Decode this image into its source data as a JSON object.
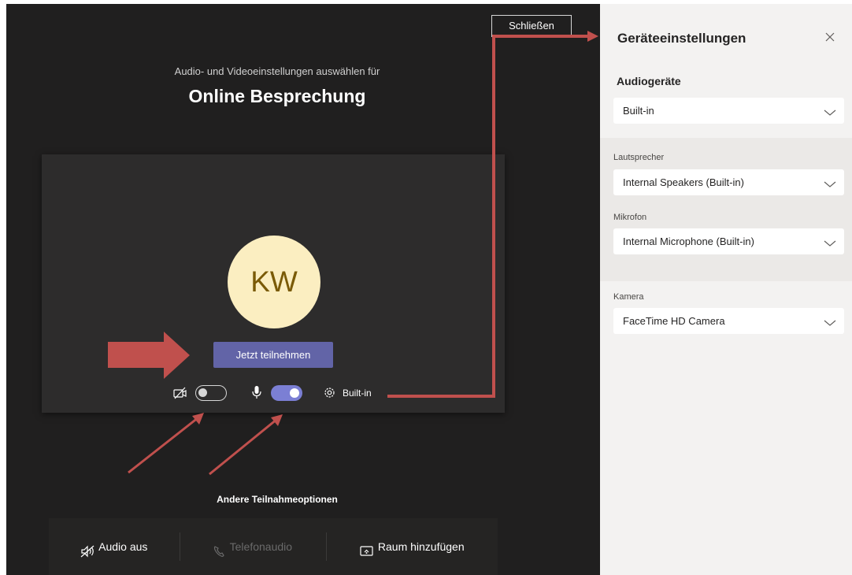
{
  "main": {
    "close_label": "Schließen",
    "subtitle": "Audio- und Videoeinstellungen auswählen für",
    "title": "Online Besprechung",
    "avatar_initials": "KW",
    "join_label": "Jetzt teilnehmen",
    "camera_toggle": {
      "on": false
    },
    "mic_toggle": {
      "on": true
    },
    "device_label": "Built-in",
    "other_options_title": "Andere Teilnahmeoptionen",
    "options": [
      {
        "label": "Audio aus",
        "icon": "speaker-off-icon",
        "enabled": true
      },
      {
        "label": "Telefonaudio",
        "icon": "phone-icon",
        "enabled": false
      },
      {
        "label": "Raum hinzufügen",
        "icon": "cast-icon",
        "enabled": true
      }
    ]
  },
  "panel": {
    "title": "Geräteeinstellungen",
    "audio_section": "Audiogeräte",
    "audio_device": "Built-in",
    "speaker_label": "Lautsprecher",
    "speaker_value": "Internal Speakers (Built-in)",
    "mic_label": "Mikrofon",
    "mic_value": "Internal Microphone (Built-in)",
    "camera_label": "Kamera",
    "camera_value": "FaceTime HD Camera"
  },
  "colors": {
    "accent": "#6264a7",
    "annotation_arrow": "#c0504d",
    "avatar_bg": "#fbeec1"
  }
}
